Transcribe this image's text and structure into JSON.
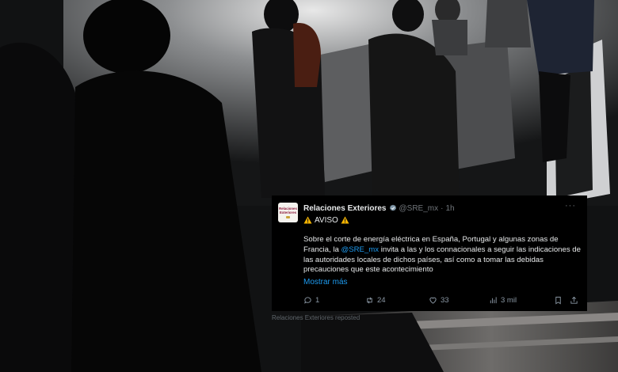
{
  "tweet": {
    "author_name": "Relaciones Exteriores",
    "handle": "@SRE_mx",
    "separator": "·",
    "time": "1h",
    "more_label": "···",
    "avatar_text": "Relaciones Exteriores",
    "aviso_label": "AVISO",
    "body_before_mention": "Sobre el corte de energía eléctrica en España, Portugal y algunas zonas de Francia, la ",
    "mention": "@SRE_mx",
    "body_after_mention": " invita a las y los connacionales a seguir las indicaciones de las autoridades locales de dichos países, así como a tomar las debidas precauciones que este acontecimiento",
    "show_more": "Mostrar más",
    "replies": "1",
    "reposts": "24",
    "likes": "33",
    "views": "3 mil"
  },
  "next_strip": {
    "text": "Relaciones Exteriores reposted"
  },
  "colors": {
    "link": "#1d9bf0",
    "card_bg": "#000000",
    "muted": "#71767b"
  },
  "icons": [
    "verified-badge-icon",
    "warning-icon",
    "more-icon",
    "reply-icon",
    "repost-icon",
    "like-icon",
    "views-icon",
    "bookmark-icon",
    "share-icon"
  ]
}
